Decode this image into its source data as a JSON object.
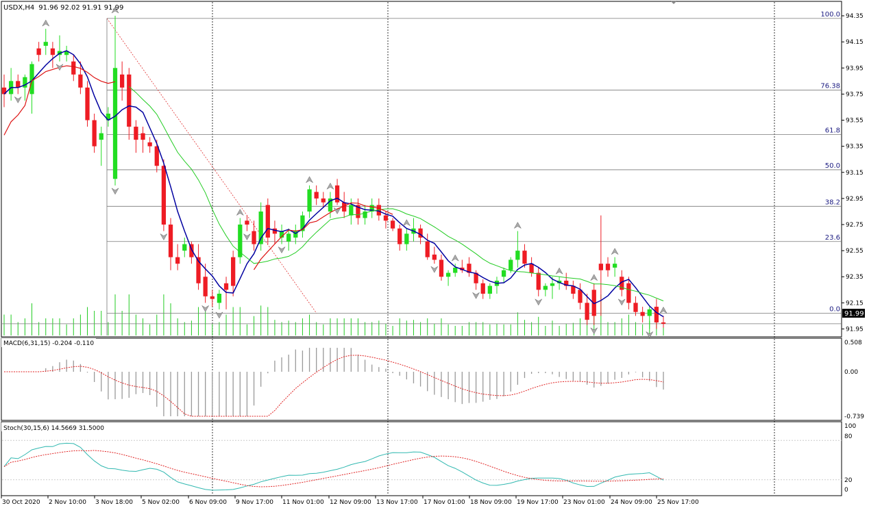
{
  "main": {
    "symbol": "USDX,H4",
    "ohlc": "91.96 92.02 91.91 91.99",
    "current_price": "91.99",
    "ylim": [
      91.9,
      94.45
    ],
    "y_ticks": [
      "94.35",
      "94.15",
      "93.95",
      "93.75",
      "93.55",
      "93.35",
      "93.15",
      "92.95",
      "92.75",
      "92.55",
      "92.35",
      "92.15",
      "91.95"
    ],
    "fib_levels": [
      {
        "label": "100.0",
        "price": 94.33
      },
      {
        "label": "76.38",
        "price": 93.78
      },
      {
        "label": "61.8",
        "price": 93.44
      },
      {
        "label": "50.0",
        "price": 93.17
      },
      {
        "label": "38.2",
        "price": 92.89
      },
      {
        "label": "23.6",
        "price": 92.62
      },
      {
        "label": "0.0",
        "price": 92.07
      }
    ]
  },
  "macd": {
    "label": "MACD(6,31,15) -0.204 -0.110",
    "y_ticks": [
      "0.508",
      "0.00",
      "-0.739"
    ]
  },
  "stoch": {
    "label": "Stoch(30,15,6) 14.5669 31.5000",
    "y_ticks": [
      "100",
      "80",
      "20",
      "0"
    ]
  },
  "x_labels": [
    "30 Oct 2020",
    "2 Nov 10:00",
    "3 Nov 18:00",
    "5 Nov 02:00",
    "6 Nov 09:00",
    "9 Nov 17:00",
    "11 Nov 01:00",
    "12 Nov 09:00",
    "13 Nov 17:00",
    "17 Nov 01:00",
    "18 Nov 09:00",
    "19 Nov 17:00",
    "23 Nov 01:00",
    "24 Nov 09:00",
    "25 Nov 17:00"
  ],
  "chart_data": {
    "type": "candlestick",
    "title": "USDX,H4",
    "ylim": [
      91.9,
      94.45
    ],
    "candles": [
      [
        93.8,
        93.9,
        93.65,
        93.75
      ],
      [
        93.75,
        93.95,
        93.7,
        93.85
      ],
      [
        93.85,
        93.9,
        93.75,
        93.8
      ],
      [
        93.8,
        93.9,
        93.7,
        93.88
      ],
      [
        93.75,
        94.0,
        93.6,
        93.98
      ],
      [
        94.1,
        94.15,
        94.0,
        94.05
      ],
      [
        94.12,
        94.25,
        94.05,
        94.15
      ],
      [
        94.1,
        94.15,
        93.95,
        94.05
      ],
      [
        94.05,
        94.2,
        94.0,
        94.08
      ],
      [
        94.05,
        94.12,
        94.0,
        94.08
      ],
      [
        94.0,
        94.05,
        93.85,
        93.9
      ],
      [
        93.9,
        94.0,
        93.75,
        93.8
      ],
      [
        93.8,
        93.85,
        93.5,
        93.55
      ],
      [
        93.55,
        93.6,
        93.3,
        93.35
      ],
      [
        93.4,
        93.5,
        93.2,
        93.45
      ],
      [
        93.55,
        93.65,
        93.5,
        93.6
      ],
      [
        93.1,
        94.35,
        93.05,
        93.95
      ],
      [
        93.9,
        94.0,
        93.7,
        93.8
      ],
      [
        93.9,
        93.95,
        93.4,
        93.5
      ],
      [
        93.5,
        93.55,
        93.3,
        93.4
      ],
      [
        93.45,
        93.5,
        93.3,
        93.4
      ],
      [
        93.38,
        93.42,
        93.3,
        93.35
      ],
      [
        93.35,
        93.4,
        93.15,
        93.2
      ],
      [
        93.2,
        93.25,
        92.7,
        92.75
      ],
      [
        92.75,
        92.8,
        92.4,
        92.5
      ],
      [
        92.5,
        92.6,
        92.4,
        92.45
      ],
      [
        92.55,
        92.65,
        92.5,
        92.6
      ],
      [
        92.6,
        92.62,
        92.45,
        92.5
      ],
      [
        92.5,
        92.6,
        92.25,
        92.3
      ],
      [
        92.35,
        92.45,
        92.15,
        92.2
      ],
      [
        92.2,
        92.25,
        92.12,
        92.18
      ],
      [
        92.15,
        92.25,
        92.1,
        92.22
      ],
      [
        92.3,
        92.35,
        92.1,
        92.25
      ],
      [
        92.5,
        92.55,
        92.2,
        92.28
      ],
      [
        92.5,
        92.8,
        92.45,
        92.75
      ],
      [
        92.78,
        92.82,
        92.7,
        92.75
      ],
      [
        92.7,
        92.78,
        92.55,
        92.6
      ],
      [
        92.6,
        92.92,
        92.55,
        92.85
      ],
      [
        92.9,
        92.95,
        92.6,
        92.65
      ],
      [
        92.72,
        92.78,
        92.6,
        92.68
      ],
      [
        92.65,
        92.75,
        92.6,
        92.7
      ],
      [
        92.62,
        92.72,
        92.55,
        92.68
      ],
      [
        92.65,
        92.75,
        92.6,
        92.7
      ],
      [
        92.7,
        92.85,
        92.65,
        92.82
      ],
      [
        92.85,
        93.05,
        92.8,
        93.02
      ],
      [
        93.0,
        93.05,
        92.9,
        92.95
      ],
      [
        92.95,
        93.0,
        92.88,
        92.92
      ],
      [
        92.85,
        93.0,
        92.8,
        92.95
      ],
      [
        93.05,
        93.1,
        92.9,
        92.92
      ],
      [
        92.92,
        93.0,
        92.8,
        92.85
      ],
      [
        92.82,
        92.95,
        92.75,
        92.9
      ],
      [
        92.9,
        92.95,
        92.75,
        92.8
      ],
      [
        92.8,
        92.9,
        92.75,
        92.85
      ],
      [
        92.85,
        92.95,
        92.8,
        92.9
      ],
      [
        92.9,
        92.95,
        92.78,
        92.82
      ],
      [
        92.82,
        92.85,
        92.72,
        92.78
      ],
      [
        92.78,
        92.8,
        92.7,
        92.72
      ],
      [
        92.72,
        92.75,
        92.55,
        92.6
      ],
      [
        92.6,
        92.72,
        92.55,
        92.68
      ],
      [
        92.68,
        92.8,
        92.62,
        92.72
      ],
      [
        92.72,
        92.75,
        92.6,
        92.65
      ],
      [
        92.62,
        92.68,
        92.48,
        92.5
      ],
      [
        92.52,
        92.58,
        92.45,
        92.48
      ],
      [
        92.48,
        92.52,
        92.32,
        92.35
      ],
      [
        92.35,
        92.4,
        92.28,
        92.38
      ],
      [
        92.38,
        92.45,
        92.35,
        92.42
      ],
      [
        92.42,
        92.48,
        92.38,
        92.4
      ],
      [
        92.45,
        92.5,
        92.35,
        92.38
      ],
      [
        92.38,
        92.4,
        92.25,
        92.3
      ],
      [
        92.3,
        92.33,
        92.18,
        92.22
      ],
      [
        92.22,
        92.3,
        92.18,
        92.28
      ],
      [
        92.28,
        92.35,
        92.22,
        92.32
      ],
      [
        92.35,
        92.42,
        92.3,
        92.4
      ],
      [
        92.4,
        92.5,
        92.38,
        92.48
      ],
      [
        92.48,
        92.7,
        92.42,
        92.55
      ],
      [
        92.55,
        92.6,
        92.42,
        92.45
      ],
      [
        92.45,
        92.5,
        92.35,
        92.38
      ],
      [
        92.38,
        92.42,
        92.2,
        92.25
      ],
      [
        92.25,
        92.3,
        92.2,
        92.28
      ],
      [
        92.28,
        92.35,
        92.18,
        92.3
      ],
      [
        92.3,
        92.35,
        92.25,
        92.32
      ],
      [
        92.32,
        92.38,
        92.25,
        92.28
      ],
      [
        92.28,
        92.32,
        92.18,
        92.22
      ],
      [
        92.25,
        92.3,
        92.1,
        92.15
      ],
      [
        92.15,
        92.22,
        91.98,
        92.02
      ],
      [
        92.25,
        92.3,
        91.98,
        92.05
      ],
      [
        92.45,
        92.82,
        92.05,
        92.4
      ],
      [
        92.45,
        92.5,
        92.35,
        92.4
      ],
      [
        92.42,
        92.5,
        92.35,
        92.45
      ],
      [
        92.35,
        92.4,
        92.2,
        92.25
      ],
      [
        92.3,
        92.35,
        92.1,
        92.15
      ],
      [
        92.15,
        92.2,
        92.05,
        92.08
      ],
      [
        92.08,
        92.12,
        92.0,
        92.05
      ],
      [
        92.05,
        92.12,
        91.95,
        92.1
      ],
      [
        92.12,
        92.18,
        91.95,
        92.0
      ],
      [
        92.0,
        92.05,
        91.96,
        91.99
      ]
    ]
  }
}
